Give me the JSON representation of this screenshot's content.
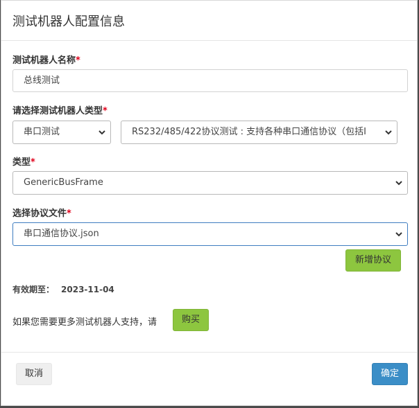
{
  "dialog": {
    "title": "测试机器人配置信息"
  },
  "form": {
    "robot_name": {
      "label": "测试机器人名称",
      "required_mark": "*",
      "value": "总线测试"
    },
    "robot_type": {
      "label": "请选择测试机器人类型",
      "required_mark": "*",
      "category_value": "串口测试",
      "protocol_value": "RS232/485/422协议测试 : 支持各种串口通信协议（包括I"
    },
    "type": {
      "label": "类型",
      "required_mark": "*",
      "value": "GenericBusFrame"
    },
    "protocol_file": {
      "label": "选择协议文件",
      "required_mark": "*",
      "value": "串口通信协议.json",
      "add_button": "新增协议"
    }
  },
  "expiry": {
    "label": "有效期至：",
    "date": "2023-11-04"
  },
  "purchase": {
    "text": "如果您需要更多测试机器人支持，请",
    "button": "购买"
  },
  "footer": {
    "cancel": "取消",
    "confirm": "确定"
  },
  "icons": {
    "select_arrow": "chevron-down-icon"
  },
  "colors": {
    "accent_green": "#8dc63f",
    "primary_blue": "#3b8ec7",
    "required_red": "#e0001a"
  }
}
